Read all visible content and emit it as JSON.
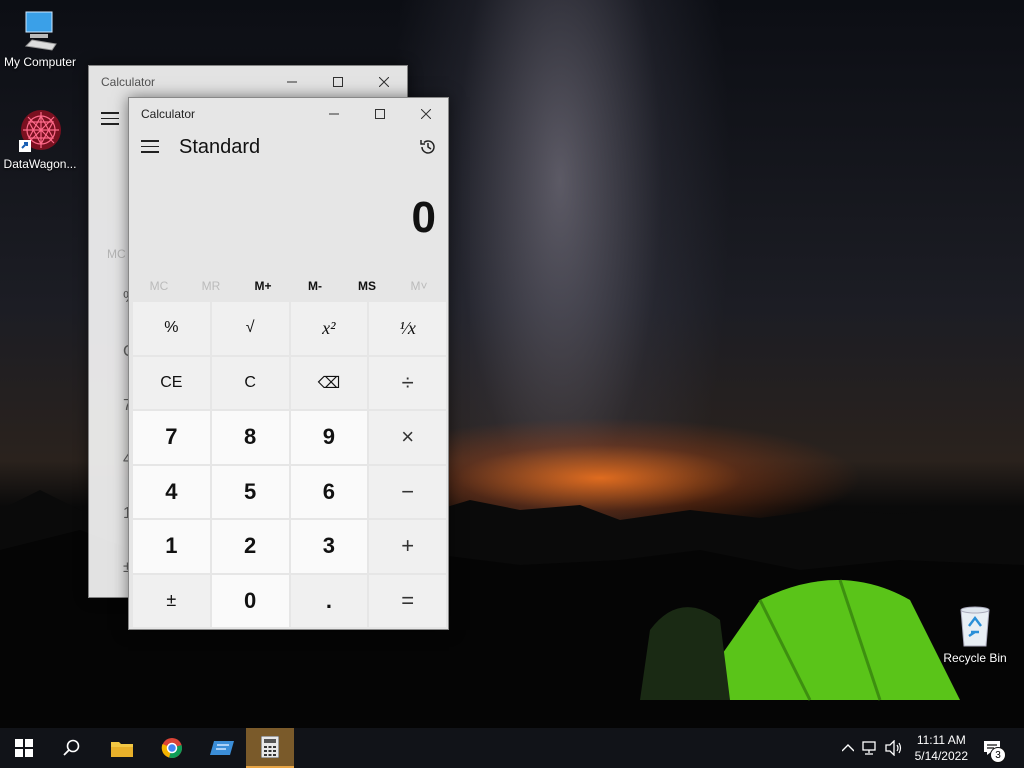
{
  "desktop": {
    "icons": [
      {
        "label": "My Computer"
      },
      {
        "label": "DataWagon..."
      },
      {
        "label": "Recycle Bin"
      }
    ]
  },
  "back_window": {
    "title": "Calculator",
    "mem_partial": "MC",
    "col_partial": [
      "%",
      "C",
      "7",
      "4",
      "1",
      "±"
    ]
  },
  "calculator": {
    "title": "Calculator",
    "mode": "Standard",
    "display": "0",
    "memory": [
      {
        "label": "MC",
        "enabled": false
      },
      {
        "label": "MR",
        "enabled": false
      },
      {
        "label": "M+",
        "enabled": true
      },
      {
        "label": "M-",
        "enabled": true
      },
      {
        "label": "MS",
        "enabled": true
      },
      {
        "label": "M˅",
        "enabled": false
      }
    ],
    "keys": {
      "percent": "%",
      "sqrt": "√",
      "square": "x²",
      "reciprocal": "¹⁄x",
      "ce": "CE",
      "clear": "C",
      "backspace": "⌫",
      "divide": "÷",
      "seven": "7",
      "eight": "8",
      "nine": "9",
      "multiply": "×",
      "four": "4",
      "five": "5",
      "six": "6",
      "minus": "−",
      "one": "1",
      "two": "2",
      "three": "3",
      "plus": "+",
      "negate": "±",
      "zero": "0",
      "decimal": ".",
      "equals": "="
    }
  },
  "taskbar": {
    "time": "11:11 AM",
    "date": "5/14/2022",
    "notifications": "3",
    "accent": "#e8a545"
  }
}
